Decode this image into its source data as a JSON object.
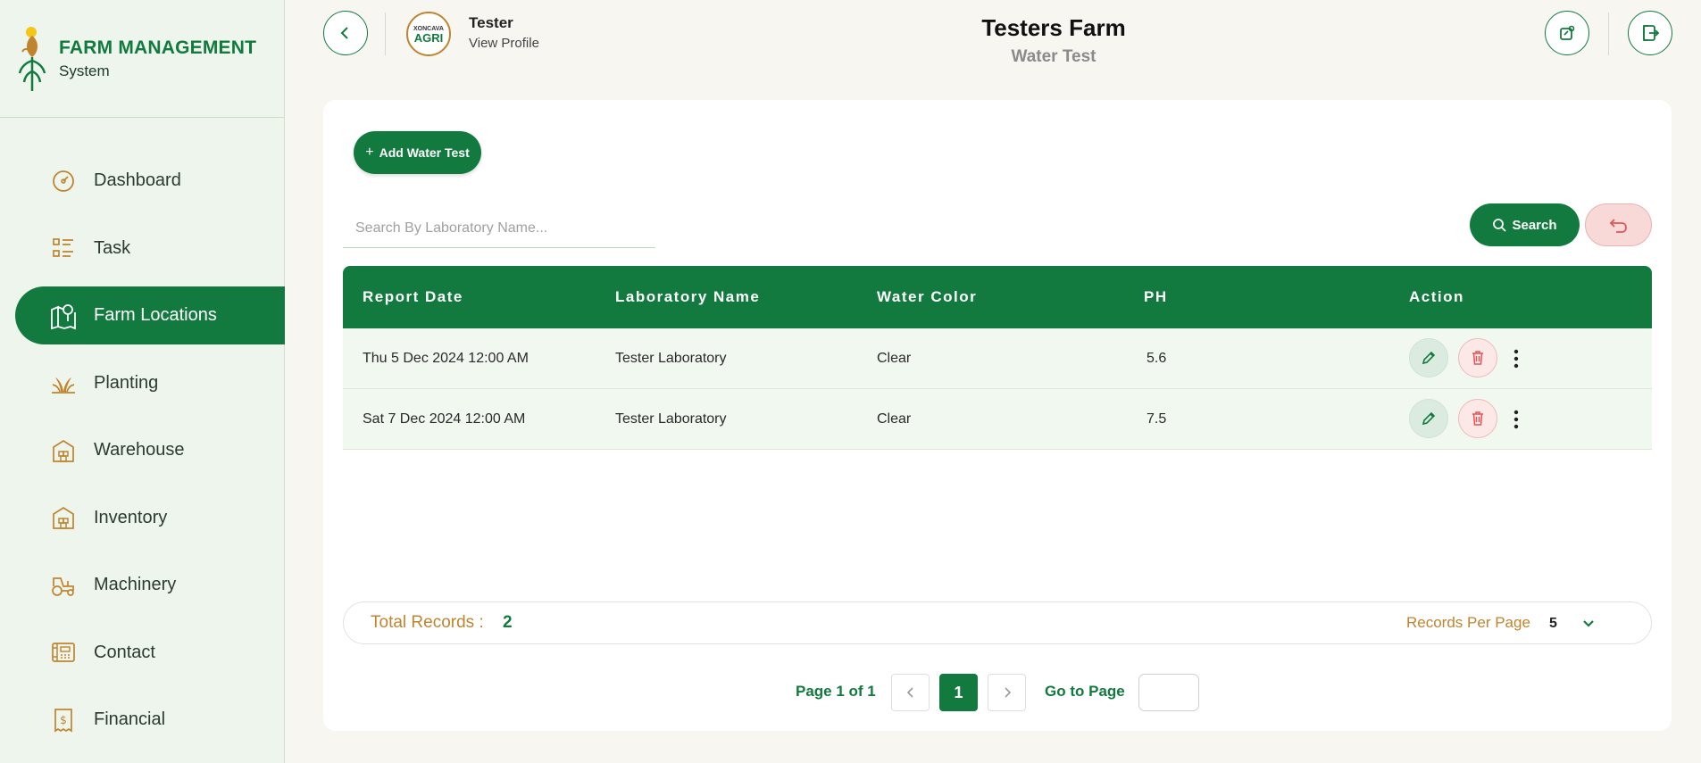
{
  "brand": {
    "title": "FARM MANAGEMENT",
    "subtitle": "System"
  },
  "sidebar": {
    "items": [
      {
        "label": "Dashboard",
        "icon": "dashboard-icon",
        "active": false
      },
      {
        "label": "Task",
        "icon": "task-list-icon",
        "active": false
      },
      {
        "label": "Farm Locations",
        "icon": "map-pin-icon",
        "active": true
      },
      {
        "label": "Planting",
        "icon": "plant-icon",
        "active": false
      },
      {
        "label": "Warehouse",
        "icon": "warehouse-icon",
        "active": false
      },
      {
        "label": "Inventory",
        "icon": "inventory-icon",
        "active": false
      },
      {
        "label": "Machinery",
        "icon": "tractor-icon",
        "active": false
      },
      {
        "label": "Contact",
        "icon": "contact-icon",
        "active": false
      },
      {
        "label": "Financial",
        "icon": "financial-icon",
        "active": false
      }
    ]
  },
  "header": {
    "user_name": "Tester",
    "view_profile": "View Profile",
    "avatar_text_top": "XONCAVA",
    "avatar_text_bottom": "AGRI",
    "title": "Testers Farm",
    "subtitle": "Water Test"
  },
  "toolbar": {
    "add_label": "Add Water Test",
    "search_placeholder": "Search By Laboratory Name...",
    "search_label": "Search"
  },
  "table": {
    "columns": [
      "Report Date",
      "Laboratory Name",
      "Water Color",
      "PH",
      "Action"
    ],
    "rows": [
      {
        "report_date": "Thu 5 Dec 2024 12:00 AM",
        "laboratory_name": "Tester Laboratory",
        "water_color": "Clear",
        "ph": "5.6"
      },
      {
        "report_date": "Sat 7 Dec 2024 12:00 AM",
        "laboratory_name": "Tester Laboratory",
        "water_color": "Clear",
        "ph": "7.5"
      }
    ]
  },
  "footer": {
    "total_label": "Total Records :",
    "total_value": "2",
    "rpp_label": "Records Per Page",
    "rpp_value": "5"
  },
  "pagination": {
    "page_label": "Page 1 of 1",
    "current_page": "1",
    "goto_label": "Go to Page"
  },
  "colors": {
    "primary": "#127a3e",
    "accent": "#c0842f",
    "danger": "#e05555",
    "sidebar_bg": "#eef5ec"
  }
}
